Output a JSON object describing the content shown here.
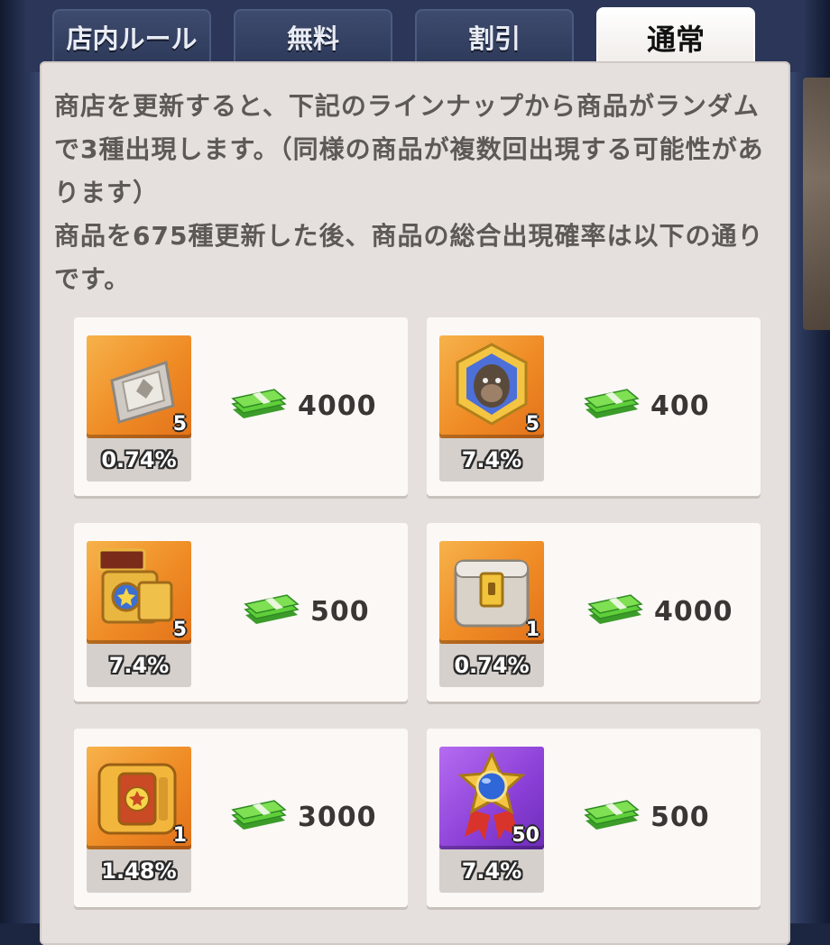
{
  "tabs": [
    {
      "label": "店内ルール",
      "active": false
    },
    {
      "label": "無料",
      "active": false
    },
    {
      "label": "割引",
      "active": false
    },
    {
      "label": "通常",
      "active": true
    }
  ],
  "description": {
    "line1": "商店を更新すると、下記のラインナップから商品がランダムで3種出現します。（同様の商品が複数回出現する可能性があります）",
    "line2": "商品を675種更新した後、商品の総合出現確率は以下の通りです。"
  },
  "currency_icon": "cash-stack-icon",
  "items": [
    {
      "icon": "silver-ticket-icon",
      "tile_color": "orange",
      "quantity": "5",
      "rate": "0.74%",
      "price": "4000"
    },
    {
      "icon": "gorilla-portrait-icon",
      "tile_color": "orange",
      "quantity": "5",
      "rate": "7.4%",
      "price": "400"
    },
    {
      "icon": "tier-viii-item-set-icon",
      "tile_color": "orange",
      "quantity": "5",
      "rate": "7.4%",
      "price": "500"
    },
    {
      "icon": "silver-gold-chest-icon",
      "tile_color": "orange",
      "quantity": "1",
      "rate": "0.74%",
      "price": "4000"
    },
    {
      "icon": "golden-star-chest-icon",
      "tile_color": "orange",
      "quantity": "1",
      "rate": "1.48%",
      "price": "3000"
    },
    {
      "icon": "blue-gem-star-medal-icon",
      "tile_color": "purple",
      "quantity": "50",
      "rate": "7.4%",
      "price": "500"
    }
  ],
  "colors": {
    "tile_orange": "#ef8b25",
    "tile_purple": "#8a3fd6",
    "panel": "#e5e0dd",
    "card": "#fbf8f6",
    "cash_green": "#5fcf3a"
  }
}
